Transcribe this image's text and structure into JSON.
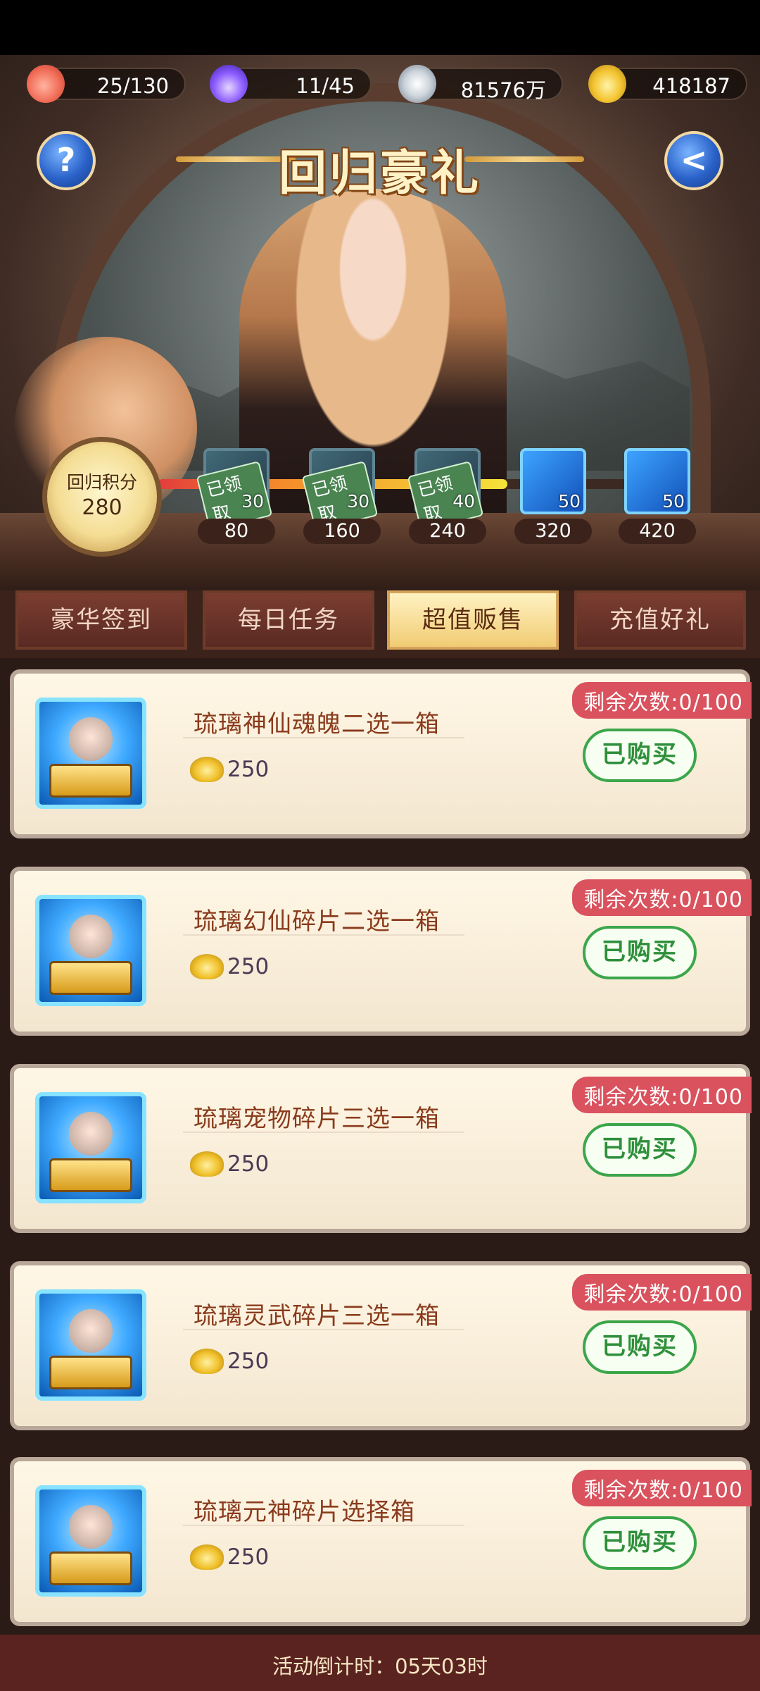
{
  "resources": [
    {
      "icon": "peach-icon",
      "value": "25/130"
    },
    {
      "icon": "spirit-flame-icon",
      "value": "11/45"
    },
    {
      "icon": "copper-coin-icon",
      "value": "81576万"
    },
    {
      "icon": "gold-ingot-icon",
      "value": "418187"
    }
  ],
  "header": {
    "title": "回归豪礼",
    "help_label": "?",
    "back_label": "<"
  },
  "points": {
    "label": "回归积分",
    "value": "280"
  },
  "progress": {
    "fraction": 0.67
  },
  "rewards": [
    {
      "threshold": "80",
      "count": "30",
      "claimed": true,
      "stamp": "已领取"
    },
    {
      "threshold": "160",
      "count": "30",
      "claimed": true,
      "stamp": "已领取"
    },
    {
      "threshold": "240",
      "count": "40",
      "claimed": true,
      "stamp": "已领取"
    },
    {
      "threshold": "320",
      "count": "50",
      "claimed": false,
      "stamp": ""
    },
    {
      "threshold": "420",
      "count": "50",
      "claimed": false,
      "stamp": ""
    }
  ],
  "tabs": [
    {
      "label": "豪华签到",
      "active": false
    },
    {
      "label": "每日任务",
      "active": false
    },
    {
      "label": "超值贩售",
      "active": true
    },
    {
      "label": "充值好礼",
      "active": false
    }
  ],
  "items": [
    {
      "name": "琉璃神仙魂魄二选一箱",
      "price": "250",
      "remaining": "剩余次数:0/100",
      "button": "已购买"
    },
    {
      "name": "琉璃幻仙碎片二选一箱",
      "price": "250",
      "remaining": "剩余次数:0/100",
      "button": "已购买"
    },
    {
      "name": "琉璃宠物碎片三选一箱",
      "price": "250",
      "remaining": "剩余次数:0/100",
      "button": "已购买"
    },
    {
      "name": "琉璃灵武碎片三选一箱",
      "price": "250",
      "remaining": "剩余次数:0/100",
      "button": "已购买"
    },
    {
      "name": "琉璃元神碎片选择箱",
      "price": "250",
      "remaining": "剩余次数:0/100",
      "button": "已购买"
    }
  ],
  "footer": {
    "countdown": "活动倒计时：05天03时"
  },
  "colors": {
    "accent_red": "#d9525d",
    "buy_green": "#3ca64b",
    "tab_active": "#f1cc74",
    "title_gold": "#fff2c6"
  }
}
